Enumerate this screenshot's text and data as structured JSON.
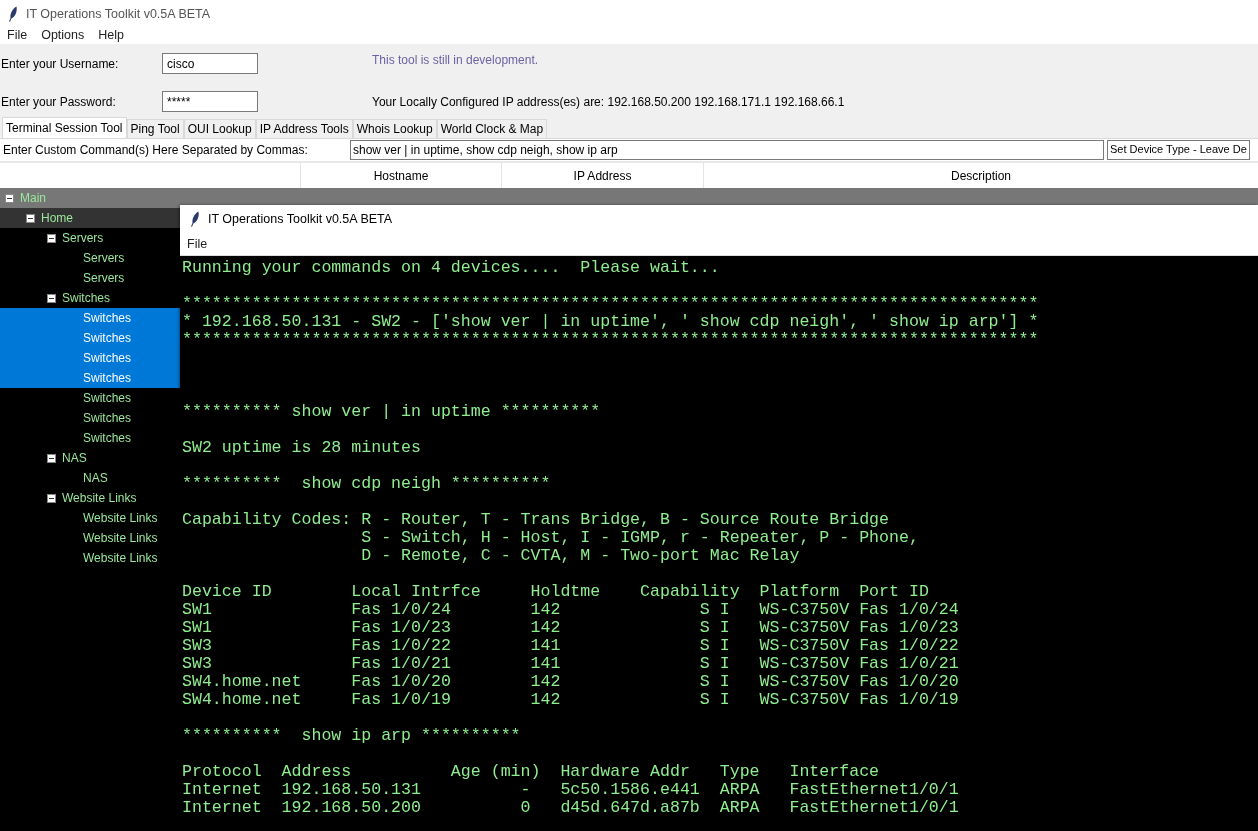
{
  "window": {
    "title": "IT Operations Toolkit v0.5A BETA"
  },
  "menu": [
    "File",
    "Options",
    "Help"
  ],
  "login": {
    "username_label": "Enter your Username:",
    "username": "cisco",
    "password_label": "Enter your Password:",
    "password": "*****"
  },
  "notice": "This tool is still in development.",
  "ip_info": "Your Locally Configured IP address(es) are: 192.168.50.200 192.168.171.1 192.168.66.1",
  "tabs": [
    {
      "label": "Terminal Session Tool",
      "selected": true
    },
    {
      "label": "Ping Tool",
      "selected": false
    },
    {
      "label": "OUI Lookup",
      "selected": false
    },
    {
      "label": "IP Address Tools",
      "selected": false
    },
    {
      "label": "Whois Lookup",
      "selected": false
    },
    {
      "label": "World Clock & Map",
      "selected": false
    }
  ],
  "command": {
    "label": "Enter Custom Command(s) Here Separated by Commas:",
    "value": "show ver | in uptime, show cdp neigh, show ip arp",
    "device_type": "Set Device Type - Leave De"
  },
  "table": {
    "columns": [
      "Hostname",
      "IP Address",
      "Description"
    ]
  },
  "tree": [
    {
      "label": "Main",
      "expanded": true,
      "selected": false,
      "children": [
        {
          "label": "Home",
          "expanded": true,
          "selected": false,
          "children": [
            {
              "label": "Servers",
              "expanded": true,
              "selected": false,
              "children": [
                {
                  "label": "Servers",
                  "selected": false
                },
                {
                  "label": "Servers",
                  "selected": false
                }
              ]
            },
            {
              "label": "Switches",
              "expanded": true,
              "selected": false,
              "children": [
                {
                  "label": "Switches",
                  "selected": true
                },
                {
                  "label": "Switches",
                  "selected": true
                },
                {
                  "label": "Switches",
                  "selected": true
                },
                {
                  "label": "Switches",
                  "selected": true
                },
                {
                  "label": "Switches",
                  "selected": false
                },
                {
                  "label": "Switches",
                  "selected": false
                },
                {
                  "label": "Switches",
                  "selected": false
                }
              ]
            },
            {
              "label": "NAS",
              "expanded": true,
              "selected": false,
              "children": [
                {
                  "label": "NAS",
                  "selected": false
                }
              ]
            },
            {
              "label": "Website Links",
              "expanded": true,
              "selected": false,
              "children": [
                {
                  "label": "Website Links",
                  "selected": false
                },
                {
                  "label": "Website Links",
                  "selected": false
                },
                {
                  "label": "Website Links",
                  "selected": false
                }
              ]
            }
          ]
        }
      ]
    }
  ],
  "terminal_window": {
    "title": "IT Operations Toolkit v0.5A BETA",
    "menu": [
      "File"
    ],
    "output": "Running your commands on 4 devices....  Please wait...\n\n**************************************************************************************\n* 192.168.50.131 - SW2 - ['show ver | in uptime', ' show cdp neigh', ' show ip arp'] *\n**************************************************************************************\n\n\n\n********** show ver | in uptime **********\n\nSW2 uptime is 28 minutes\n\n**********  show cdp neigh **********\n\nCapability Codes: R - Router, T - Trans Bridge, B - Source Route Bridge\n                  S - Switch, H - Host, I - IGMP, r - Repeater, P - Phone,\n                  D - Remote, C - CVTA, M - Two-port Mac Relay\n\nDevice ID        Local Intrfce     Holdtme    Capability  Platform  Port ID\nSW1              Fas 1/0/24        142              S I   WS-C3750V Fas 1/0/24\nSW1              Fas 1/0/23        142              S I   WS-C3750V Fas 1/0/23\nSW3              Fas 1/0/22        141              S I   WS-C3750V Fas 1/0/22\nSW3              Fas 1/0/21        141              S I   WS-C3750V Fas 1/0/21\nSW4.home.net     Fas 1/0/20        142              S I   WS-C3750V Fas 1/0/20\nSW4.home.net     Fas 1/0/19        142              S I   WS-C3750V Fas 1/0/19\n\n**********  show ip arp **********\n\nProtocol  Address          Age (min)  Hardware Addr   Type   Interface\nInternet  192.168.50.131          -   5c50.1586.e441  ARPA   FastEthernet1/0/1\nInternet  192.168.50.200          0   d45d.647d.a87b  ARPA   FastEthernet1/0/1"
  }
}
